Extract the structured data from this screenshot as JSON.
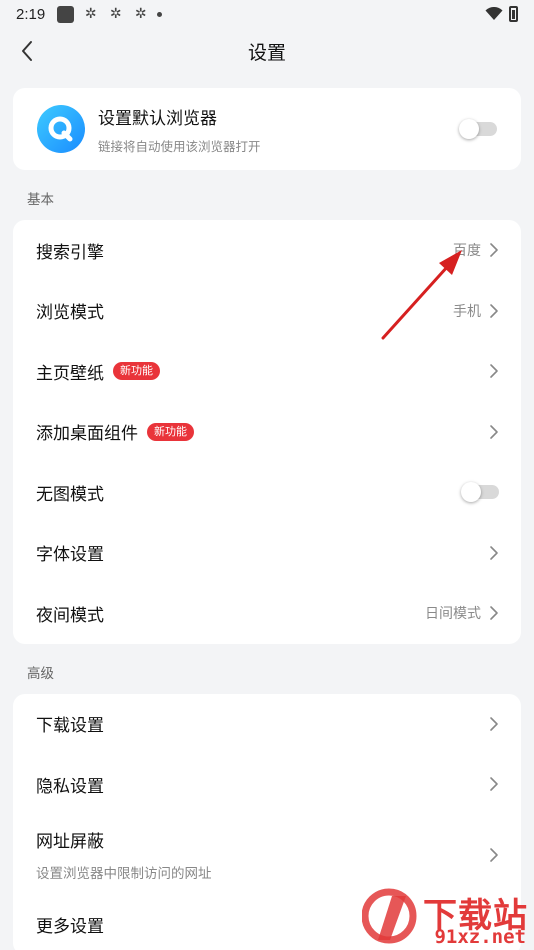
{
  "status_bar": {
    "time": "2:19"
  },
  "header": {
    "title": "设置"
  },
  "default_browser": {
    "title": "设置默认浏览器",
    "subtitle": "链接将自动使用该浏览器打开",
    "enabled": false
  },
  "basic": {
    "section_label": "基本",
    "items": [
      {
        "label": "搜索引擎",
        "value": "百度"
      },
      {
        "label": "浏览模式",
        "value": "手机"
      },
      {
        "label": "主页壁纸",
        "badge": "新功能"
      },
      {
        "label": "添加桌面组件",
        "badge": "新功能"
      },
      {
        "label": "无图模式",
        "toggle": false
      },
      {
        "label": "字体设置"
      },
      {
        "label": "夜间模式",
        "value": "日间模式"
      }
    ]
  },
  "advanced": {
    "section_label": "高级",
    "items": [
      {
        "label": "下载设置"
      },
      {
        "label": "隐私设置"
      },
      {
        "label": "网址屏蔽",
        "subtitle": "设置浏览器中限制访问的网址"
      },
      {
        "label": "更多设置"
      }
    ]
  },
  "watermark": {
    "line1": "下载站",
    "line2": "91xz.net"
  },
  "colors": {
    "accent_red": "#e9343a",
    "logo_blue": "#1a8cff",
    "annotation_arrow": "#d62020"
  }
}
